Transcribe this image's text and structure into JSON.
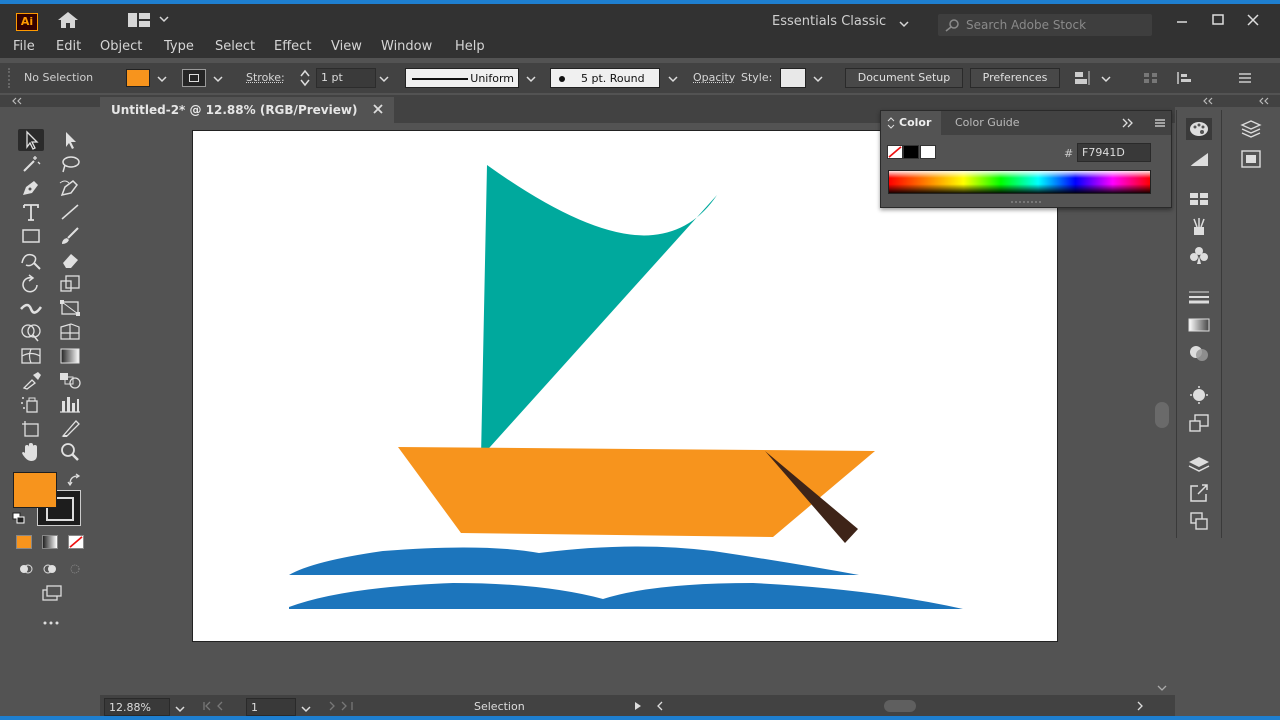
{
  "app": {
    "logo": "Ai",
    "workspace": "Essentials Classic",
    "search_placeholder": "Search Adobe Stock"
  },
  "menu": [
    "File",
    "Edit",
    "Object",
    "Type",
    "Select",
    "Effect",
    "View",
    "Window",
    "Help"
  ],
  "control_bar": {
    "selection": "No Selection",
    "stroke_label": "Stroke:",
    "stroke_weight": "1 pt",
    "profile": "Uniform",
    "brush": "5 pt. Round",
    "opacity_label": "Opacity",
    "style_label": "Style:",
    "document_setup": "Document Setup",
    "preferences": "Preferences"
  },
  "document": {
    "tab_title": "Untitled-2* @ 12.88% (RGB/Preview)"
  },
  "color_panel": {
    "tab_color": "Color",
    "tab_guide": "Color Guide",
    "hash": "#",
    "hex": "F7941D"
  },
  "status": {
    "zoom": "12.88%",
    "page": "1",
    "tool": "Selection"
  },
  "colors": {
    "fill": "#F7941D",
    "sail": "#00A99D",
    "hull": "#F7941D",
    "oar": "#3E2418",
    "wave": "#1C75BC",
    "app_bg": "#535353",
    "bar_bg": "#323232"
  }
}
